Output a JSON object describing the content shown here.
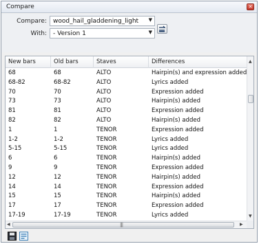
{
  "window": {
    "title": "Compare"
  },
  "form": {
    "compare_label": "Compare:",
    "compare_value": "wood_hail_gladdening_light",
    "with_label": "With:",
    "with_value": "- Version 1"
  },
  "table": {
    "columns": [
      "New bars",
      "Old bars",
      "Staves",
      "Differences"
    ],
    "rows": [
      [
        "68",
        "68",
        "ALTO",
        "Hairpin(s) and expression added"
      ],
      [
        "68-82",
        "68-82",
        "ALTO",
        "Lyrics added"
      ],
      [
        "70",
        "70",
        "ALTO",
        "Expression added"
      ],
      [
        "73",
        "73",
        "ALTO",
        "Hairpin(s) added"
      ],
      [
        "81",
        "81",
        "ALTO",
        "Expression added"
      ],
      [
        "82",
        "82",
        "ALTO",
        "Hairpin(s) added"
      ],
      [
        "1",
        "1",
        "TENOR",
        "Expression added"
      ],
      [
        "1-2",
        "1-2",
        "TENOR",
        "Lyrics added"
      ],
      [
        "5-15",
        "5-15",
        "TENOR",
        "Lyrics added"
      ],
      [
        "6",
        "6",
        "TENOR",
        "Hairpin(s) added"
      ],
      [
        "9",
        "9",
        "TENOR",
        "Expression added"
      ],
      [
        "12",
        "12",
        "TENOR",
        "Hairpin(s) added"
      ],
      [
        "14",
        "14",
        "TENOR",
        "Expression added"
      ],
      [
        "15",
        "15",
        "TENOR",
        "Hairpin(s) added"
      ],
      [
        "17",
        "17",
        "TENOR",
        "Expression added"
      ],
      [
        "17-19",
        "17-19",
        "TENOR",
        "Lyrics added"
      ]
    ]
  },
  "icons": {
    "close": "close-icon",
    "swap": "swap-icon",
    "save": "save-icon",
    "export": "export-icon"
  }
}
